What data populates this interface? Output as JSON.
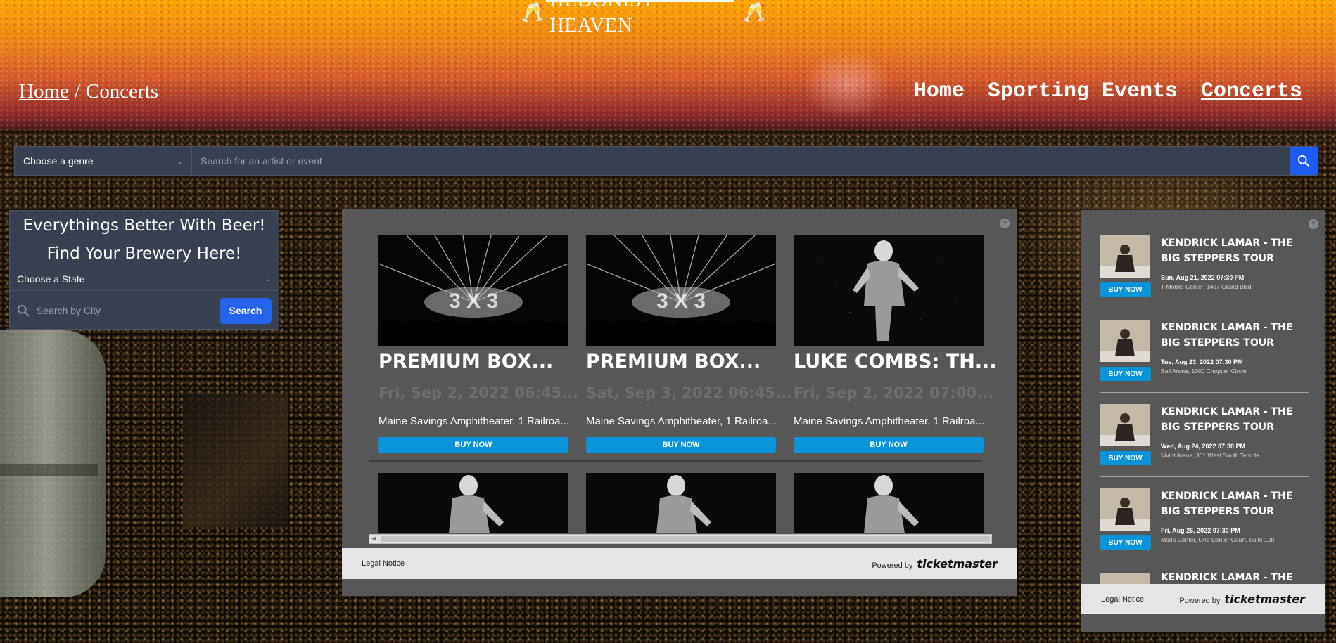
{
  "site": {
    "logo_text": "HEDONIST HEAVEN"
  },
  "breadcrumb": {
    "home": "Home",
    "separator": "/",
    "current": "Concerts"
  },
  "nav": {
    "items": [
      "Home",
      "Sporting Events",
      "Concerts"
    ],
    "active": "Concerts"
  },
  "search": {
    "genre_value": "Choose a genre",
    "placeholder": "Search for an artist or event"
  },
  "brewery": {
    "line1": "Everythings Better With Beer!",
    "line2": "Find Your Brewery Here!",
    "state_value": "Choose a State",
    "city_placeholder": "Search by City",
    "search_label": "Search"
  },
  "widget_center": {
    "help": "?",
    "events": [
      {
        "title": "PREMIUM BOX...",
        "date": "Fri, Sep 2, 2022 06:45...",
        "venue": "Maine Savings Amphitheater, 1 Railroa...",
        "buy": "BUY NOW"
      },
      {
        "title": "PREMIUM BOX...",
        "date": "Sat, Sep 3, 2022 06:45...",
        "venue": "Maine Savings Amphitheater, 1 Railroa...",
        "buy": "BUY NOW"
      },
      {
        "title": "LUKE COMBS: TH...",
        "date": "Fri, Sep 2, 2022 07:00...",
        "venue": "Maine Savings Amphitheater, 1 Railroa...",
        "buy": "BUY NOW"
      }
    ],
    "legal": "Legal Notice",
    "powered": "Powered by",
    "brand": "ticketmaster"
  },
  "widget_right": {
    "help": "?",
    "events": [
      {
        "title": "KENDRICK LAMAR - THE BIG STEPPERS TOUR",
        "date": "Sun, Aug 21, 2022 07:30 PM",
        "venue": "T-Mobile Center, 1407 Grand Blvd",
        "buy": "BUY NOW"
      },
      {
        "title": "KENDRICK LAMAR - THE BIG STEPPERS TOUR",
        "date": "Tue, Aug 23, 2022 07:30 PM",
        "venue": "Ball Arena, 1000 Chopper Circle",
        "buy": "BUY NOW"
      },
      {
        "title": "KENDRICK LAMAR - THE BIG STEPPERS TOUR",
        "date": "Wed, Aug 24, 2022 07:30 PM",
        "venue": "Vivint Arena, 301 West South Temple",
        "buy": "BUY NOW"
      },
      {
        "title": "KENDRICK LAMAR - THE BIG STEPPERS TOUR",
        "date": "Fri, Aug 26, 2022 07:30 PM",
        "venue": "Moda Center, One Center Court, Suite 100",
        "buy": "BUY NOW"
      },
      {
        "title": "KENDRICK LAMAR - THE BIG",
        "date": "",
        "venue": "",
        "buy": ""
      }
    ],
    "legal": "Legal Notice",
    "powered": "Powered by",
    "brand": "ticketmaster"
  },
  "icons": {
    "logo_left": "champagne-toast-icon",
    "logo_right": "champagne-toast-icon",
    "search": "search-icon",
    "city_search": "search-icon",
    "dropdown": "chevron-down-icon",
    "help": "help-icon"
  },
  "colors": {
    "header_top": "#ffa400",
    "header_bottom": "#8e2a2a",
    "search_button": "#1d5bf4",
    "brewery_button": "#2563eb",
    "buy_now": "#0993d8",
    "widget_bg": "#575757"
  }
}
